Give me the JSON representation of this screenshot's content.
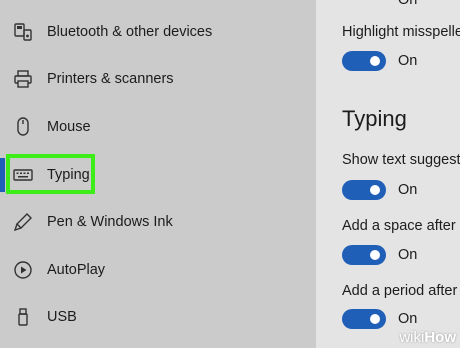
{
  "sidebar": {
    "items": [
      {
        "label": "Bluetooth & other devices",
        "icon": "bluetooth-devices-icon"
      },
      {
        "label": "Printers & scanners",
        "icon": "printer-icon"
      },
      {
        "label": "Mouse",
        "icon": "mouse-icon"
      },
      {
        "label": "Typing",
        "icon": "keyboard-icon",
        "selected": true
      },
      {
        "label": "Pen & Windows Ink",
        "icon": "pen-icon"
      },
      {
        "label": "AutoPlay",
        "icon": "autoplay-icon"
      },
      {
        "label": "USB",
        "icon": "usb-icon"
      }
    ]
  },
  "main": {
    "top_toggle_label": "On",
    "spelling_setting_1": "Highlight misspelle",
    "spelling_setting_1_toggle": "On",
    "section_title": "Typing",
    "typing_settings": [
      {
        "label": "Show text suggestio",
        "toggle": "On"
      },
      {
        "label": "Add a space after I",
        "toggle": "On"
      },
      {
        "label": "Add a period after I",
        "toggle": "On"
      }
    ]
  },
  "colors": {
    "sidebar_bg": "#cbcbcb",
    "main_bg": "#e4e4e4",
    "accent": "#1f5fb8",
    "highlight": "#3ded18"
  },
  "watermark": {
    "wiki": "wiki",
    "how": "How"
  }
}
